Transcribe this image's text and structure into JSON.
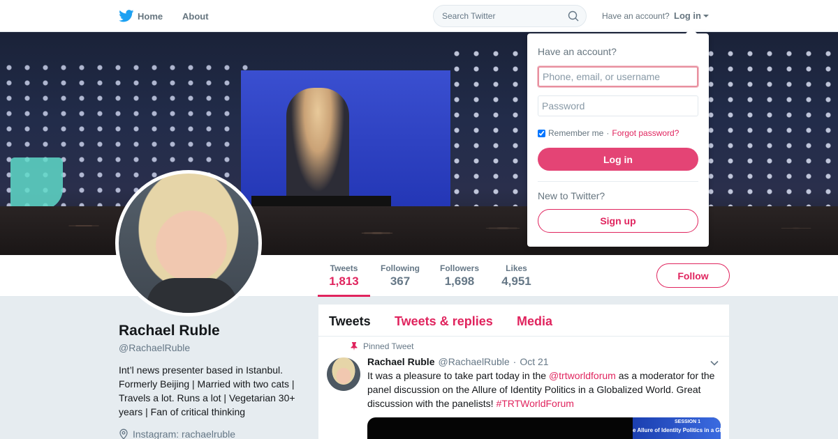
{
  "nav": {
    "home_label": "Home",
    "about_label": "About",
    "search_placeholder": "Search Twitter",
    "have_account": "Have an account?",
    "login_label": "Log in"
  },
  "profile": {
    "name": "Rachael Ruble",
    "handle": "@RachaelRuble",
    "bio": "Int’l news presenter based in Istanbul. Formerly Beijing | Married with two cats | Travels a lot. Runs a lot | Vegetarian 30+ years | Fan of critical thinking",
    "instagram": "Instagram: rachaelruble"
  },
  "stats": [
    {
      "label": "Tweets",
      "value": "1,813"
    },
    {
      "label": "Following",
      "value": "367"
    },
    {
      "label": "Followers",
      "value": "1,698"
    },
    {
      "label": "Likes",
      "value": "4,951"
    }
  ],
  "follow_label": "Follow",
  "timeline": {
    "tabs": [
      "Tweets",
      "Tweets & replies",
      "Media"
    ],
    "pinned_label": "Pinned Tweet",
    "tweet": {
      "name": "Rachael Ruble",
      "handle": "@RachaelRuble",
      "separator": "·",
      "date": "Oct 21",
      "text_1": "It was a pleasure to take part today in the ",
      "mention": "@trtworldforum",
      "text_2": " as a moderator for the panel discussion on the Allure of Identity Politics in a Globalized World. Great discussion with the panelists! ",
      "hashtag": "#TRTWorldForum",
      "media_session": "SESSION 1",
      "media_subtitle": "e Allure of Identity Politics in a Glo"
    }
  },
  "login_dropdown": {
    "title": "Have an account?",
    "username_placeholder": "Phone, email, or username",
    "password_placeholder": "Password",
    "remember_label": "Remember me",
    "separator": "·",
    "forgot_label": "Forgot password?",
    "login_button": "Log in",
    "new_label": "New to Twitter?",
    "signup_button": "Sign up"
  },
  "colors": {
    "accent": "#e0245e",
    "twitter_blue": "#1da1f2",
    "muted": "#657786"
  }
}
